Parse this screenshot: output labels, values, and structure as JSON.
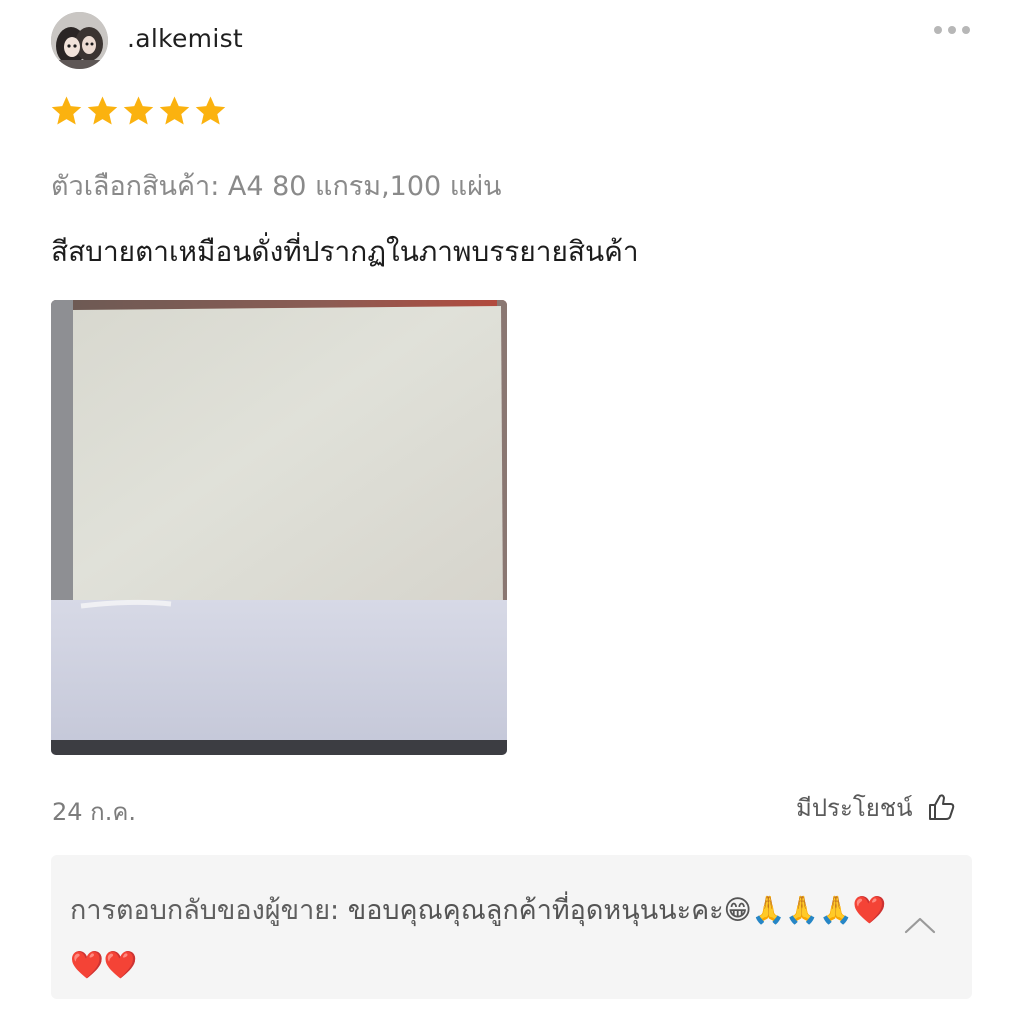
{
  "review": {
    "username": ".alkemist",
    "avatar_icon": "avatar-photo-icon",
    "more_icon": "more-dots-icon",
    "rating": 5,
    "rating_max": 5,
    "star_color": "#fbb20f",
    "variant": "ตัวเลือกสินค้า: A4 80 แกรม,100 แผ่น",
    "text": "สีสบายตาเหมือนดั่งที่ปรากฏในภาพบรรยายสินค้า",
    "date": "24 ก.ค.",
    "helpful_label": "มีประโยชน์",
    "helpful_icon": "thumbs-up-icon"
  },
  "seller_reply": {
    "label": "การตอบกลับของผู้ขาย:",
    "text": " ขอบคุณคุณลูกค้าที่อุดหนุนนะคะ😁🙏🙏🙏❤️❤️❤️",
    "collapse_icon": "chevron-up-icon"
  }
}
